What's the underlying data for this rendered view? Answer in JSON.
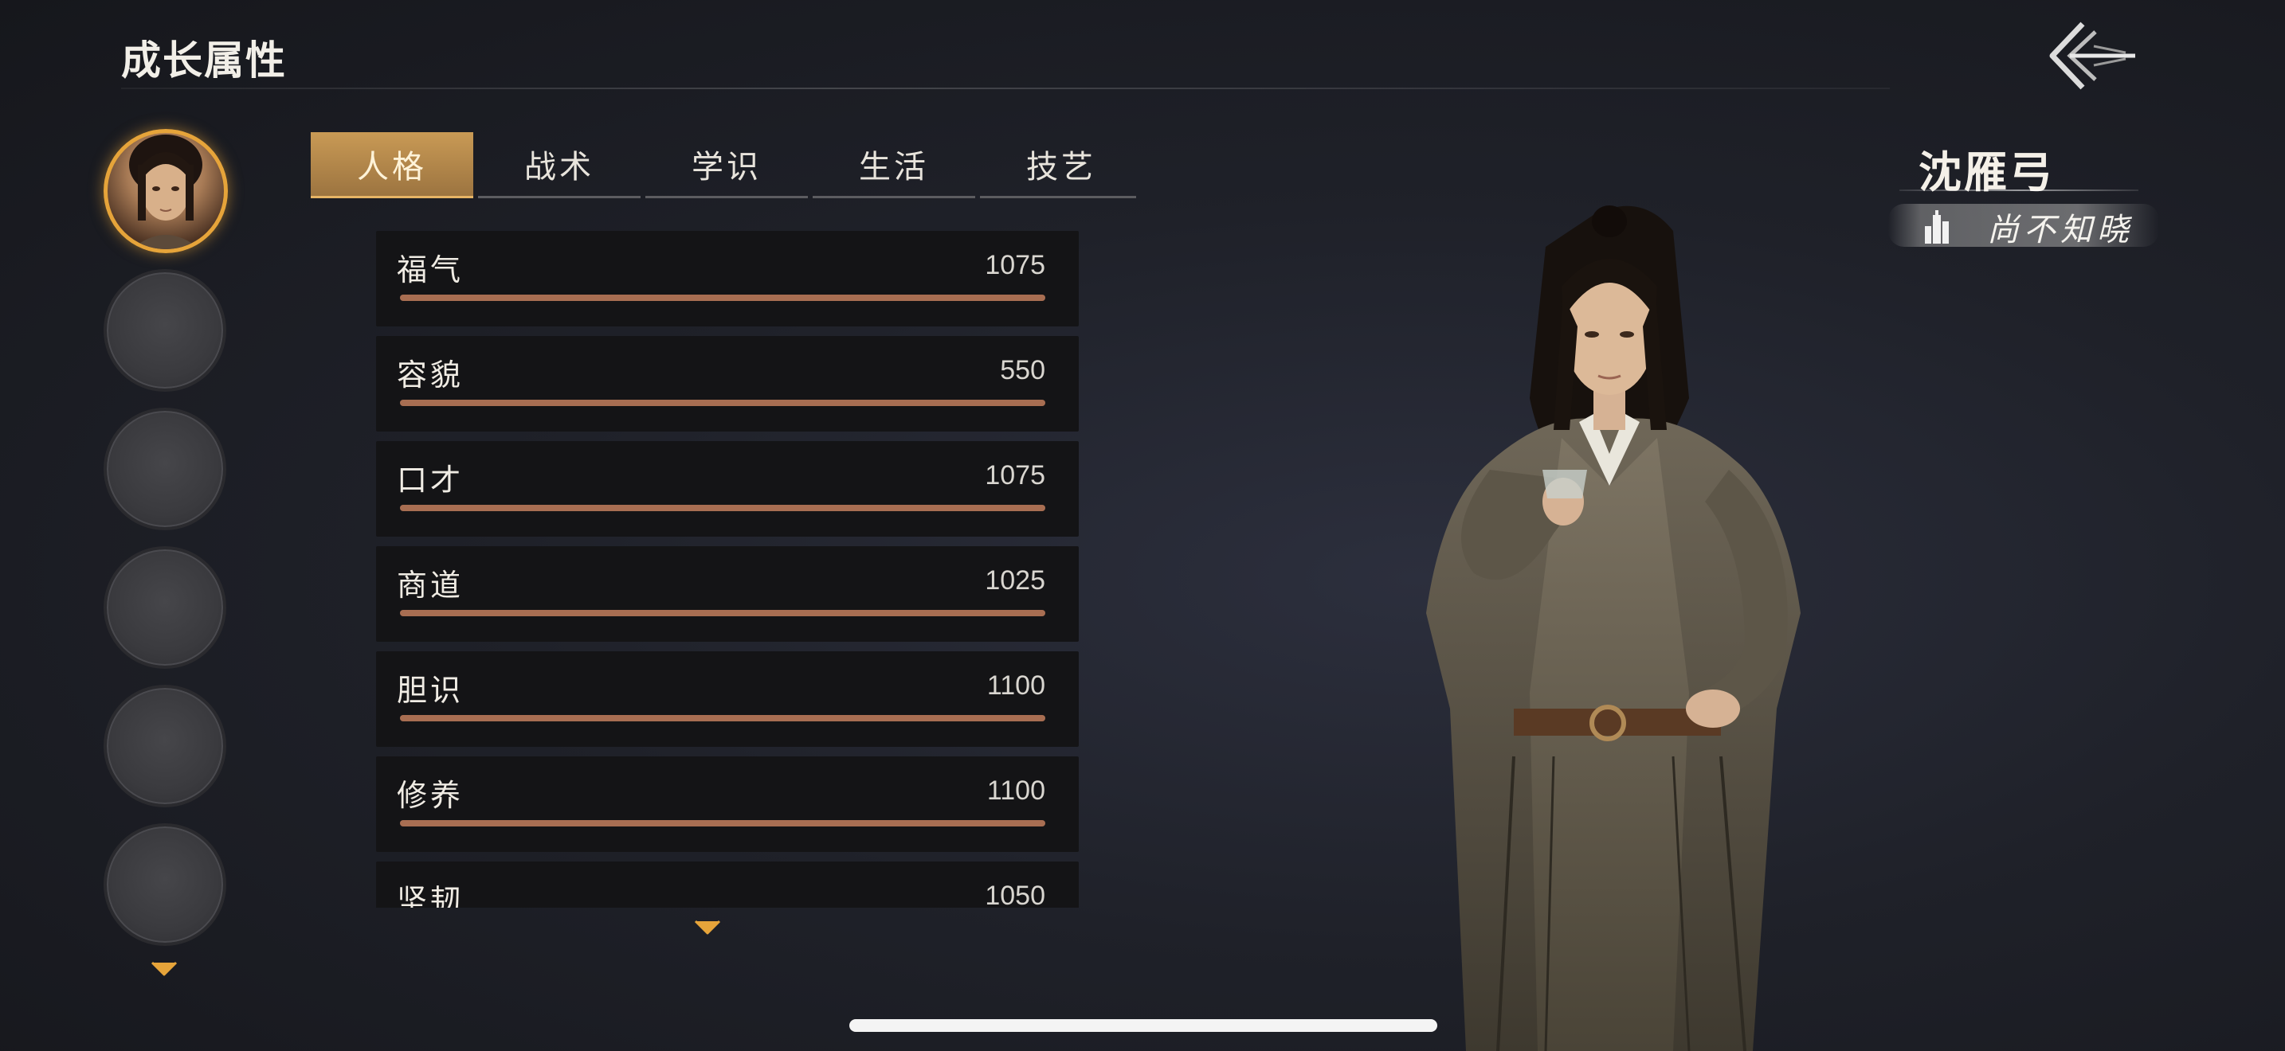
{
  "header": {
    "title": "成长属性"
  },
  "tabs": [
    {
      "label": "人格",
      "active": true
    },
    {
      "label": "战术",
      "active": false
    },
    {
      "label": "学识",
      "active": false
    },
    {
      "label": "生活",
      "active": false
    },
    {
      "label": "技艺",
      "active": false
    }
  ],
  "stats": [
    {
      "label": "福气",
      "value": "1075",
      "fill": 1.0
    },
    {
      "label": "容貌",
      "value": "550",
      "fill": 1.0
    },
    {
      "label": "口才",
      "value": "1075",
      "fill": 1.0
    },
    {
      "label": "商道",
      "value": "1025",
      "fill": 1.0
    },
    {
      "label": "胆识",
      "value": "1100",
      "fill": 1.0
    },
    {
      "label": "修养",
      "value": "1100",
      "fill": 1.0
    },
    {
      "label": "坚韧",
      "value": "1050",
      "fill": 1.0
    }
  ],
  "character": {
    "name": "沈雁弓",
    "status": "尚不知晓"
  },
  "icons": {
    "back": "back-arrow-icon",
    "scroll_down": "chevron-down-icon",
    "status": "building-icon"
  },
  "colors": {
    "accent_gold": "#e6a43a",
    "tab_active": "#c99a55",
    "bar_fill": "#a86e52",
    "row_bg": "#141416"
  }
}
